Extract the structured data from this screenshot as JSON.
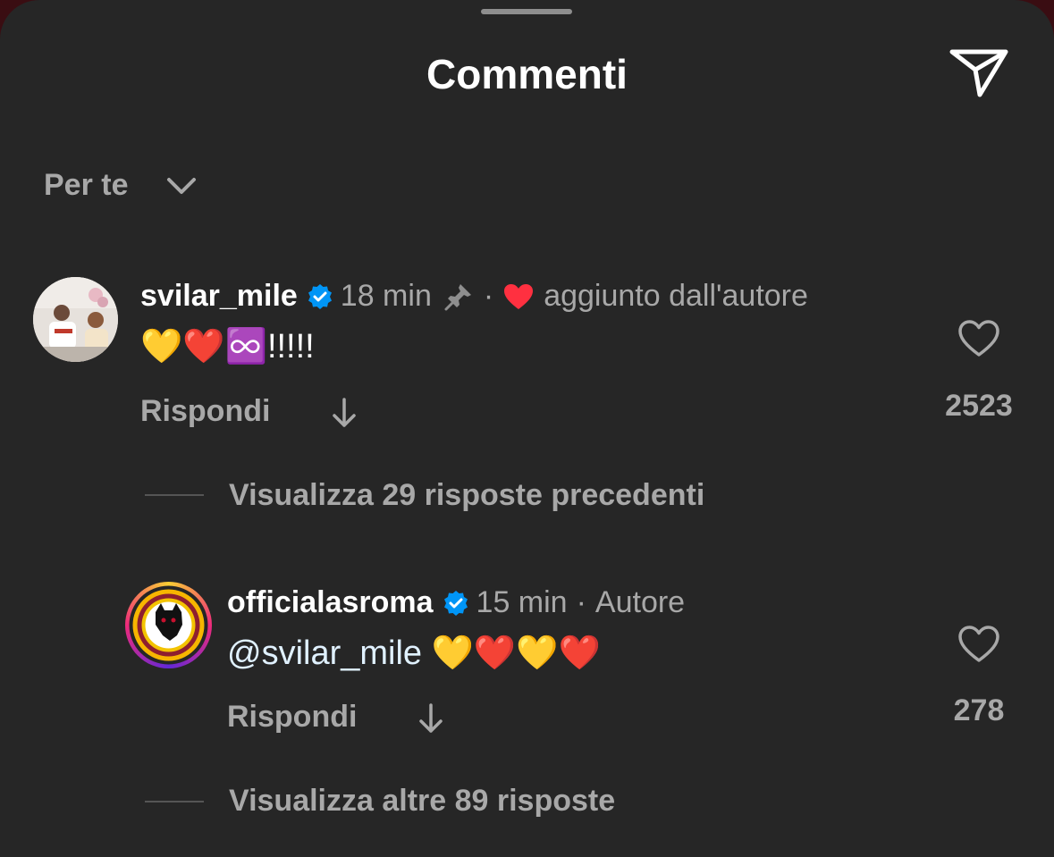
{
  "header": {
    "title": "Commenti",
    "send_icon": "paper-plane-icon"
  },
  "sort": {
    "label": "Per te",
    "icon": "chevron-down-icon"
  },
  "comments": [
    {
      "username": "svilar_mile",
      "verified": true,
      "time": "18 min",
      "pinned": true,
      "separator": "·",
      "author_liked_label": "aggiunto dall'autore",
      "text": "💛❤️♾️!!!!!",
      "reply_label": "Rispondi",
      "like_count": "2523",
      "view_replies": "Visualizza 29 risposte precedenti"
    },
    {
      "username": "officialasroma",
      "verified": true,
      "time": "15 min",
      "separator": "·",
      "author_badge": "Autore",
      "mention": "@svilar_mile",
      "text": " 💛❤️💛❤️",
      "reply_label": "Rispondi",
      "like_count": "278",
      "view_replies": "Visualizza altre 89 risposte"
    }
  ],
  "colors": {
    "sheet_bg": "#262626",
    "verified": "#0095f6",
    "heart": "#ff3040",
    "muted_text": "#a8a8a8"
  }
}
